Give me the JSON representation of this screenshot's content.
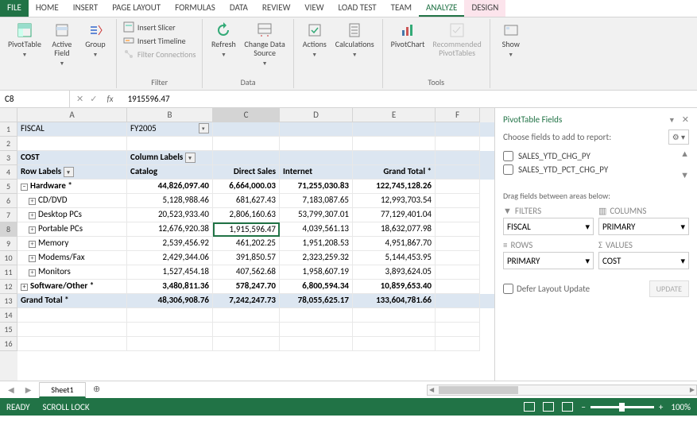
{
  "tabs": {
    "file": "FILE",
    "home": "HOME",
    "insert": "INSERT",
    "pagelayout": "PAGE LAYOUT",
    "formulas": "FORMULAS",
    "data": "DATA",
    "review": "REVIEW",
    "view": "VIEW",
    "loadtest": "LOAD TEST",
    "team": "TEAM",
    "analyze": "ANALYZE",
    "design": "DESIGN"
  },
  "ribbon": {
    "pivottable": "PivotTable",
    "activefield": "Active\nField",
    "group": "Group",
    "insertslicer": "Insert Slicer",
    "inserttimeline": "Insert Timeline",
    "filterconn": "Filter Connections",
    "filter": "Filter",
    "refresh": "Refresh",
    "changedata": "Change Data\nSource",
    "data": "Data",
    "actions": "Actions",
    "calculations": "Calculations",
    "pivotchart": "PivotChart",
    "recommended": "Recommended\nPivotTables",
    "tools": "Tools",
    "show": "Show"
  },
  "formula": {
    "name": "C8",
    "value": "1915596.47"
  },
  "cols": [
    "A",
    "B",
    "C",
    "D",
    "E",
    "F"
  ],
  "rows": [
    "1",
    "2",
    "3",
    "4",
    "5",
    "6",
    "7",
    "8",
    "9",
    "10",
    "11",
    "12",
    "13",
    "14",
    "15",
    "16"
  ],
  "data": {
    "r1": {
      "a": "FISCAL",
      "b": "FY2005"
    },
    "r3": {
      "a": "COST",
      "b": "Column Labels"
    },
    "r4": {
      "a": "Row Labels",
      "b": "Catalog",
      "c": "Direct Sales",
      "d": "Internet",
      "e": "Grand Total *"
    },
    "r5": {
      "a": "Hardware *",
      "b": "44,826,097.40",
      "c": "6,664,000.03",
      "d": "71,255,030.83",
      "e": "122,745,128.26"
    },
    "r6": {
      "a": "CD/DVD",
      "b": "5,128,988.46",
      "c": "681,627.43",
      "d": "7,183,087.65",
      "e": "12,993,703.54"
    },
    "r7": {
      "a": "Desktop PCs",
      "b": "20,523,933.40",
      "c": "2,806,160.63",
      "d": "53,799,307.01",
      "e": "77,129,401.04"
    },
    "r8": {
      "a": "Portable PCs",
      "b": "12,676,920.38",
      "c": "1,915,596.47",
      "d": "4,039,561.13",
      "e": "18,632,077.98"
    },
    "r9": {
      "a": "Memory",
      "b": "2,539,456.92",
      "c": "461,202.25",
      "d": "1,951,208.53",
      "e": "4,951,867.70"
    },
    "r10": {
      "a": "Modems/Fax",
      "b": "2,429,344.06",
      "c": "391,850.57",
      "d": "2,323,259.32",
      "e": "5,144,453.95"
    },
    "r11": {
      "a": "Monitors",
      "b": "1,527,454.18",
      "c": "407,562.68",
      "d": "1,958,607.19",
      "e": "3,893,624.05"
    },
    "r12": {
      "a": "Software/Other *",
      "b": "3,480,811.36",
      "c": "578,247.70",
      "d": "6,800,594.34",
      "e": "10,859,653.40"
    },
    "r13": {
      "a": "Grand Total *",
      "b": "48,306,908.76",
      "c": "7,242,247.73",
      "d": "78,055,625.17",
      "e": "133,604,781.66"
    }
  },
  "pane": {
    "title": "PivotTable Fields",
    "sub": "Choose fields to add to report:",
    "fields": [
      "SALES_YTD_CHG_PY",
      "SALES_YTD_PCT_CHG_PY"
    ],
    "areaslabel": "Drag fields between areas below:",
    "filters": "FILTERS",
    "columns": "COLUMNS",
    "rowsl": "ROWS",
    "values": "VALUES",
    "filterval": "FISCAL",
    "colval": "PRIMARY",
    "rowval": "PRIMARY",
    "valval": "COST",
    "defer": "Defer Layout Update",
    "update": "UPDATE"
  },
  "sheet": {
    "name": "Sheet1"
  },
  "status": {
    "ready": "READY",
    "scroll": "SCROLL LOCK",
    "zoom": "100%"
  }
}
